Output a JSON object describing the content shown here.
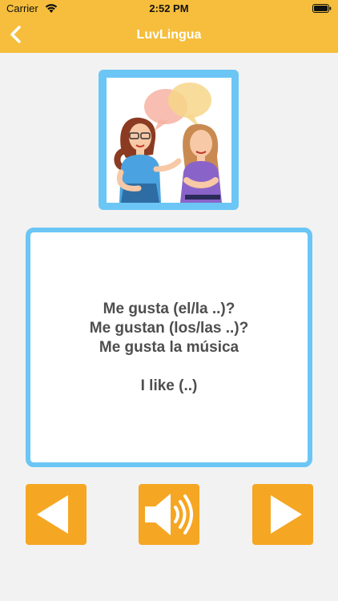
{
  "status_bar": {
    "carrier": "Carrier",
    "time": "2:52 PM",
    "icons": [
      "wifi-icon",
      "battery-icon"
    ]
  },
  "nav": {
    "title": "LuvLingua",
    "back_icon": "chevron-left-icon"
  },
  "illustration": {
    "description_icon": "two-women-talking-illustration"
  },
  "phrase": {
    "line1": "Me gusta (el/la ..)?",
    "line2": "Me gustan (los/las ..)?",
    "line3": "Me gusta la música",
    "translation": "I like (..)"
  },
  "controls": {
    "prev_icon": "triangle-left-icon",
    "sound_icon": "speaker-icon",
    "next_icon": "triangle-right-icon"
  },
  "colors": {
    "header": "#f6be3c",
    "card_border": "#6cc6f5",
    "button": "#f5a623",
    "text": "#4e4e4e"
  }
}
